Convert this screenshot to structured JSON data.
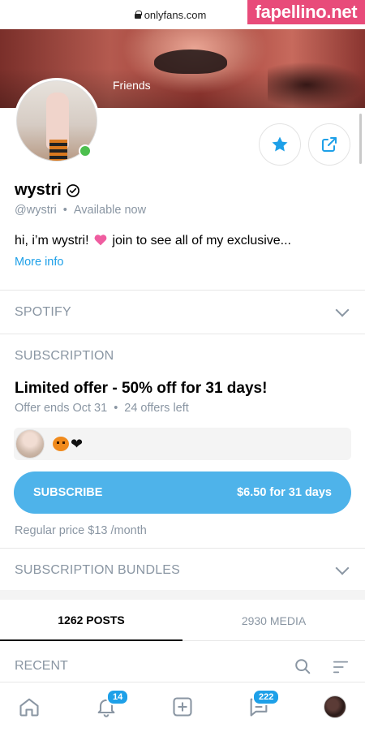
{
  "browser": {
    "url": "onlyfans.com"
  },
  "watermark": "fapellino.net",
  "cover": {
    "label": "Friends"
  },
  "profile": {
    "name": "wystri",
    "handle": "@wystri",
    "status": "Available now",
    "bio": "hi, i’m wystri!",
    "bio_rest": " join to see all of my exclusive...",
    "more_info": "More info",
    "online_color": "#4cbf4e"
  },
  "sections": {
    "spotify": "SPOTIFY",
    "subscription": "SUBSCRIPTION",
    "bundles": "SUBSCRIPTION BUNDLES",
    "recent": "RECENT"
  },
  "offer": {
    "title": "Limited offer - 50% off for 31 days!",
    "ends": "Offer ends Oct 31",
    "left": "24 offers left",
    "message_emojis": [
      "pumpkin",
      "black-heart"
    ]
  },
  "subscribe": {
    "label": "SUBSCRIBE",
    "price": "$6.50 for 31 days",
    "color": "#4eb3ea"
  },
  "regular_price": "Regular price $13 /month",
  "tabs": [
    {
      "label": "1262 POSTS",
      "active": true
    },
    {
      "label": "2930 MEDIA",
      "active": false
    }
  ],
  "nav": {
    "items": [
      {
        "icon": "home-icon"
      },
      {
        "icon": "bell-icon",
        "badge": "14"
      },
      {
        "icon": "add-post-icon"
      },
      {
        "icon": "messages-icon",
        "badge": "222"
      },
      {
        "icon": "avatar"
      }
    ]
  },
  "accent": "#1ea0e8"
}
